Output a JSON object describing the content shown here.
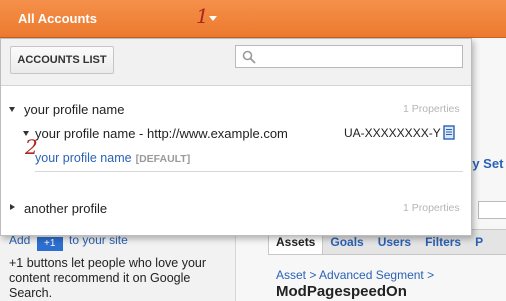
{
  "topbar": {
    "title": "All Accounts"
  },
  "annotations": {
    "first": "1",
    "second": "2"
  },
  "dropdown": {
    "accounts_list_label": "ACCOUNTS LIST",
    "search_placeholder": "",
    "accounts": [
      {
        "name": "your profile name",
        "properties_label": "1 Properties",
        "expanded": true,
        "property": {
          "name": "your profile name - http://www.example.com",
          "tracking_id": "UA-XXXXXXXX-Y",
          "profile": {
            "name": "your profile name",
            "tag": "[DEFAULT]"
          }
        }
      },
      {
        "name": "another profile",
        "properties_label": "1 Properties",
        "expanded": false
      }
    ]
  },
  "background": {
    "add_prefix": "Add",
    "add_button": "+1",
    "add_suffix": "to your site",
    "description": "+1 buttons let people who love your content recommend it on Google Search.",
    "partial_link": "ty Set",
    "tabs": [
      "Assets",
      "Goals",
      "Users",
      "Filters",
      "P"
    ],
    "breadcrumb": "Asset > Advanced Segment >",
    "heading": "ModPagespeedOn"
  },
  "colors": {
    "topbar": "#ec7a2f",
    "link": "#2a62b5",
    "annotation": "#b0261c"
  }
}
